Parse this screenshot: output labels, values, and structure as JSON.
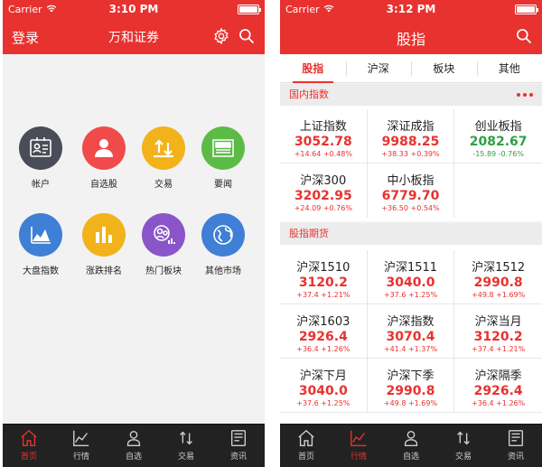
{
  "colors": {
    "brand_red": "#e8322f",
    "up": "#e8322f",
    "down": "#2ea043",
    "tabbar": "#222222"
  },
  "screen1": {
    "status": {
      "carrier": "Carrier",
      "time": "3:10 PM"
    },
    "nav": {
      "left": "登录",
      "title": "万和证券"
    },
    "tiles": [
      {
        "label": "帐户",
        "icon": "id-card-icon",
        "color": "#4a4d57"
      },
      {
        "label": "自选股",
        "icon": "user-icon",
        "color": "#f04a4a"
      },
      {
        "label": "交易",
        "icon": "transfer-icon",
        "color": "#f2b21a"
      },
      {
        "label": "要闻",
        "icon": "news-icon",
        "color": "#5cbb46"
      },
      {
        "label": "大盘指数",
        "icon": "area-chart-icon",
        "color": "#3f7fd6"
      },
      {
        "label": "涨跌排名",
        "icon": "bar-chart-icon",
        "color": "#f2b21a"
      },
      {
        "label": "热门板块",
        "icon": "group-icon",
        "color": "#8a55c9"
      },
      {
        "label": "其他市场",
        "icon": "globe-icon",
        "color": "#3f7fd6"
      }
    ],
    "tabs": [
      {
        "label": "首页",
        "icon": "home-icon",
        "active": true
      },
      {
        "label": "行情",
        "icon": "line-chart-icon",
        "active": false
      },
      {
        "label": "自选",
        "icon": "person-icon",
        "active": false
      },
      {
        "label": "交易",
        "icon": "transfer-icon",
        "active": false
      },
      {
        "label": "资讯",
        "icon": "newspaper-icon",
        "active": false
      }
    ]
  },
  "screen2": {
    "status": {
      "carrier": "Carrier",
      "time": "3:12 PM"
    },
    "nav": {
      "title": "股指"
    },
    "segments": [
      {
        "label": "股指",
        "active": true
      },
      {
        "label": "沪深",
        "active": false
      },
      {
        "label": "板块",
        "active": false
      },
      {
        "label": "其他",
        "active": false
      }
    ],
    "sections": [
      {
        "title": "国内指数",
        "cells": [
          {
            "name": "上证指数",
            "value": "3052.78",
            "change": "+14.64  +0.48%",
            "dir": "up"
          },
          {
            "name": "深证成指",
            "value": "9988.25",
            "change": "+38.33  +0.39%",
            "dir": "up"
          },
          {
            "name": "创业板指",
            "value": "2082.67",
            "change": "-15.89  -0.76%",
            "dir": "down"
          },
          {
            "name": "沪深300",
            "value": "3202.95",
            "change": "+24.09  +0.76%",
            "dir": "up"
          },
          {
            "name": "中小板指",
            "value": "6779.70",
            "change": "+36.50  +0.54%",
            "dir": "up"
          }
        ]
      },
      {
        "title": "股指期货",
        "cells": [
          {
            "name": "沪深1510",
            "value": "3120.2",
            "change": "+37.4  +1.21%",
            "dir": "up"
          },
          {
            "name": "沪深1511",
            "value": "3040.0",
            "change": "+37.6  +1.25%",
            "dir": "up"
          },
          {
            "name": "沪深1512",
            "value": "2990.8",
            "change": "+49.8  +1.69%",
            "dir": "up"
          },
          {
            "name": "沪深1603",
            "value": "2926.4",
            "change": "+36.4  +1.26%",
            "dir": "up"
          },
          {
            "name": "沪深指数",
            "value": "3070.4",
            "change": "+41.4  +1.37%",
            "dir": "up"
          },
          {
            "name": "沪深当月",
            "value": "3120.2",
            "change": "+37.4  +1.21%",
            "dir": "up"
          },
          {
            "name": "沪深下月",
            "value": "3040.0",
            "change": "+37.6  +1.25%",
            "dir": "up"
          },
          {
            "name": "沪深下季",
            "value": "2990.8",
            "change": "+49.8  +1.69%",
            "dir": "up"
          },
          {
            "name": "沪深隔季",
            "value": "2926.4",
            "change": "+36.4  +1.26%",
            "dir": "up"
          }
        ]
      }
    ],
    "tabs": [
      {
        "label": "首页",
        "icon": "home-icon",
        "active": false
      },
      {
        "label": "行情",
        "icon": "line-chart-icon",
        "active": true
      },
      {
        "label": "自选",
        "icon": "person-icon",
        "active": false
      },
      {
        "label": "交易",
        "icon": "transfer-icon",
        "active": false
      },
      {
        "label": "资讯",
        "icon": "newspaper-icon",
        "active": false
      }
    ]
  }
}
